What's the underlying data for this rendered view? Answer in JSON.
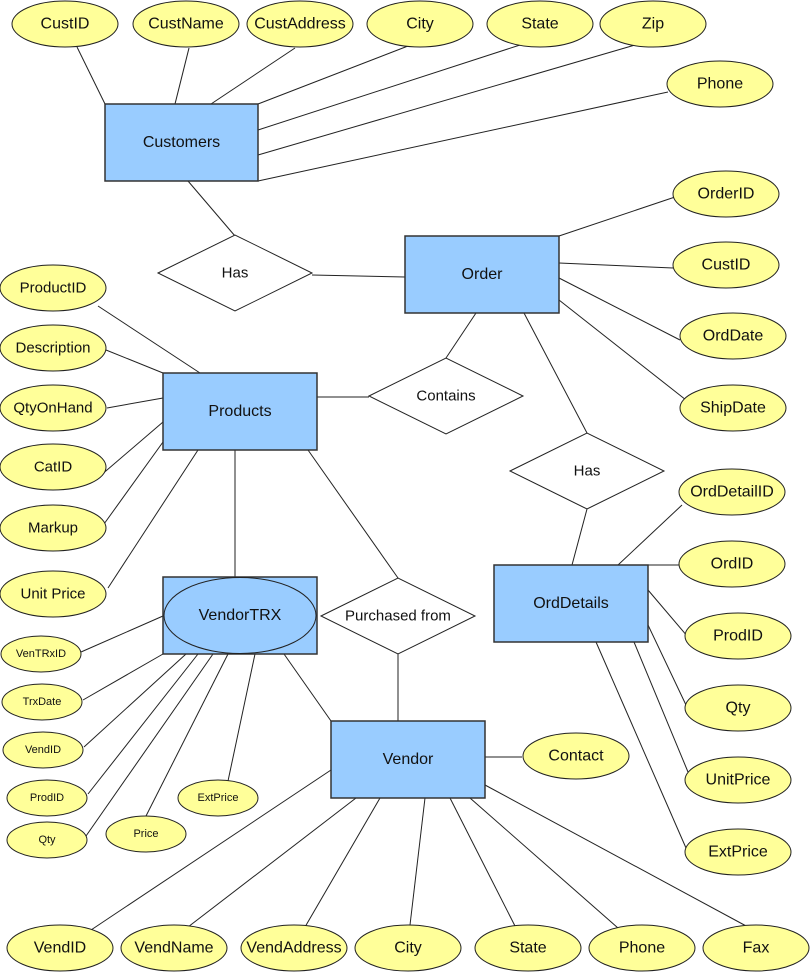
{
  "colors": {
    "entity_fill": "#99CCFF",
    "attribute_fill": "#FFFF99",
    "relationship_fill": "#FFFFFF",
    "stroke": "#333333"
  },
  "entities": {
    "customers": "Customers",
    "order": "Order",
    "products": "Products",
    "vendortrx": "VendorTRX",
    "vendor": "Vendor",
    "orddetails": "OrdDetails"
  },
  "relationships": {
    "has_customer_order": "Has",
    "contains": "Contains",
    "has_order_details": "Has",
    "purchased_from": "Purchased from"
  },
  "attributes": {
    "customers": [
      "CustID",
      "CustName",
      "CustAddress",
      "City",
      "State",
      "Zip",
      "Phone"
    ],
    "order": [
      "OrderID",
      "CustID",
      "OrdDate",
      "ShipDate"
    ],
    "products": [
      "ProductID",
      "Description",
      "QtyOnHand",
      "CatID",
      "Markup",
      "Unit Price"
    ],
    "vendortrx": [
      "VenTRxID",
      "TrxDate",
      "VendID",
      "ProdID",
      "Qty",
      "Price",
      "ExtPrice"
    ],
    "orddetails": [
      "OrdDetailID",
      "OrdID",
      "ProdID",
      "Qty",
      "UnitPrice",
      "ExtPrice"
    ],
    "vendor": [
      "Contact",
      "VendID",
      "VendName",
      "VendAddress",
      "City",
      "State",
      "Phone",
      "Fax"
    ]
  }
}
